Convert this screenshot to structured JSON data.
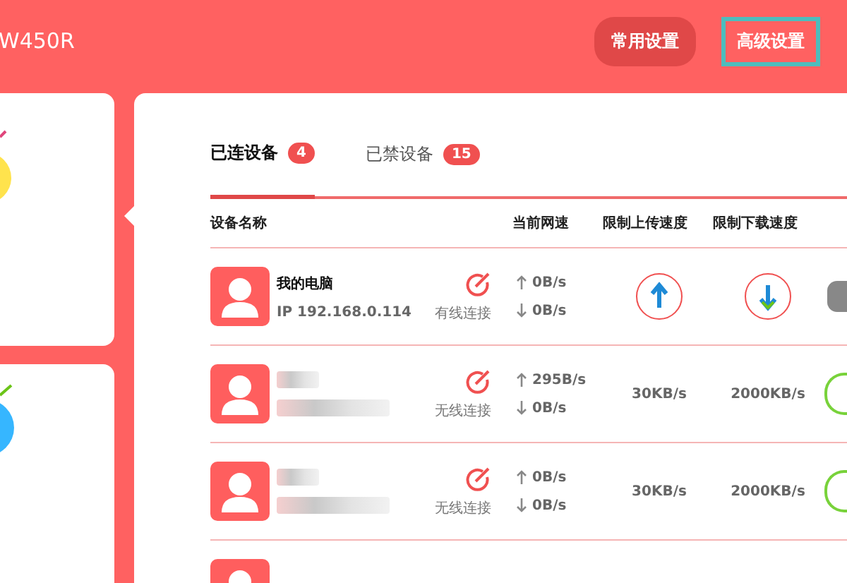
{
  "header": {
    "title": "W450R",
    "buttons": [
      {
        "label": "常用设置",
        "selected": false
      },
      {
        "label": "高级设置",
        "selected": true
      }
    ]
  },
  "tabs": [
    {
      "label": "已连设备",
      "count": "4",
      "selected": true
    },
    {
      "label": "已禁设备",
      "count": "15",
      "selected": false
    }
  ],
  "table": {
    "columns": [
      "设备名称",
      "当前网速",
      "限制上传速度",
      "限制下载速度"
    ],
    "rows": [
      {
        "name": "我的电脑",
        "ip": "IP 192.168.0.114",
        "connection": "有线连接",
        "up": "0B/s",
        "down": "0B/s",
        "limited": false
      },
      {
        "connection": "无线连接",
        "up": "295B/s",
        "down": "0B/s",
        "limited": true,
        "upload_limit": "30KB/s",
        "download_limit": "2000KB/s"
      },
      {
        "connection": "无线连接",
        "up": "0B/s",
        "down": "0B/s",
        "limited": true,
        "upload_limit": "30KB/s",
        "download_limit": "2000KB/s"
      }
    ]
  }
}
